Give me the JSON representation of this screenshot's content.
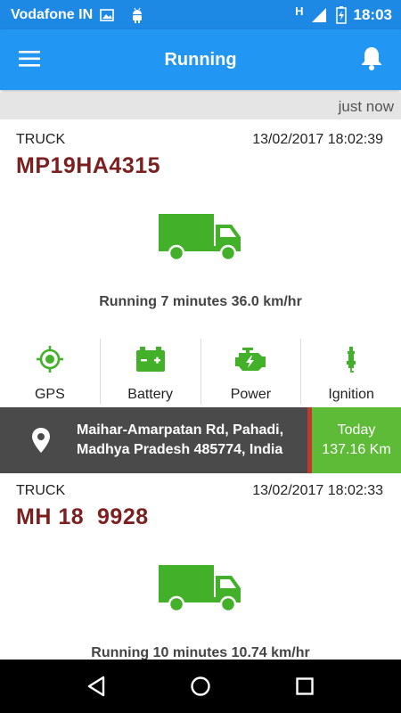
{
  "status_bar": {
    "carrier": "Vodafone IN",
    "network": "H",
    "time": "18:03"
  },
  "app_bar": {
    "title": "Running"
  },
  "refresh": {
    "label": "just now"
  },
  "vehicles": [
    {
      "type": "TRUCK",
      "timestamp": "13/02/2017 18:02:39",
      "plate": "MP19HA4315",
      "status_text": "Running 7 minutes 36.0 km/hr",
      "indicators": [
        {
          "label": "GPS",
          "icon": "gps-icon"
        },
        {
          "label": "Battery",
          "icon": "battery-icon"
        },
        {
          "label": "Power",
          "icon": "engine-icon"
        },
        {
          "label": "Ignition",
          "icon": "spark-plug-icon"
        }
      ],
      "location": {
        "address_line1": "Maihar-Amarpatan Rd, Pahadi,",
        "address_line2": "Madhya Pradesh 485774, India"
      },
      "distance": {
        "label": "Today",
        "value": "137.16 Km"
      }
    },
    {
      "type": "TRUCK",
      "timestamp": "13/02/2017 18:02:33",
      "plate": "MH 18  9928",
      "status_text": "Running 10 minutes 10.74 km/hr"
    }
  ],
  "colors": {
    "primary": "#2196f3",
    "status_bar": "#1e88e5",
    "accent_green": "#5dbb37",
    "icon_green": "#43b02a",
    "plate_red": "#7b1f1f",
    "divider_red": "#c0392b",
    "address_bg": "#4a4a4a"
  }
}
